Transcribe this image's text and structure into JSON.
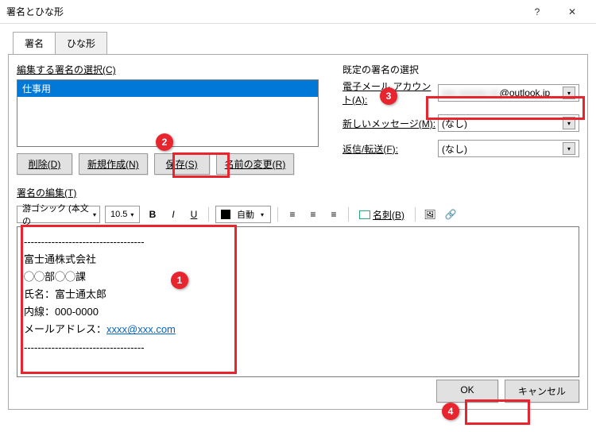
{
  "window": {
    "title": "署名とひな形",
    "help": "?",
    "close": "✕"
  },
  "tabs": {
    "signature": "署名",
    "template": "ひな形"
  },
  "left": {
    "select_label": "編集する署名の選択(C)",
    "items": [
      "仕事用"
    ],
    "delete": "削除(D)",
    "new": "新規作成(N)",
    "save": "保存(S)",
    "rename": "名前の変更(R)"
  },
  "right": {
    "title": "既定の署名の選択",
    "account_label": "電子メール アカウント(A):",
    "account_value_visible": "@outlook.jp",
    "new_msg_label": "新しいメッセージ(M):",
    "new_msg_value": "(なし)",
    "reply_label": "返信/転送(F):",
    "reply_value": "(なし)"
  },
  "editor": {
    "label": "署名の編集(T)",
    "font": "游ゴシック (本文の",
    "size": "10.5",
    "auto": "自動",
    "bizcard": "名刺(B)",
    "content": {
      "divider": "-----------------------------------",
      "company": "富士通株式会社",
      "dept": "◯◯部◯◯課",
      "name_label": "氏名：",
      "name": "富士通太郎",
      "ext_label": "内線：",
      "ext": "000-0000",
      "mail_label": "メールアドレス：",
      "mail": "xxxx@xxx.com"
    }
  },
  "footer": {
    "ok": "OK",
    "cancel": "キャンセル"
  },
  "annot": {
    "n1": "1",
    "n2": "2",
    "n3": "3",
    "n4": "4"
  }
}
